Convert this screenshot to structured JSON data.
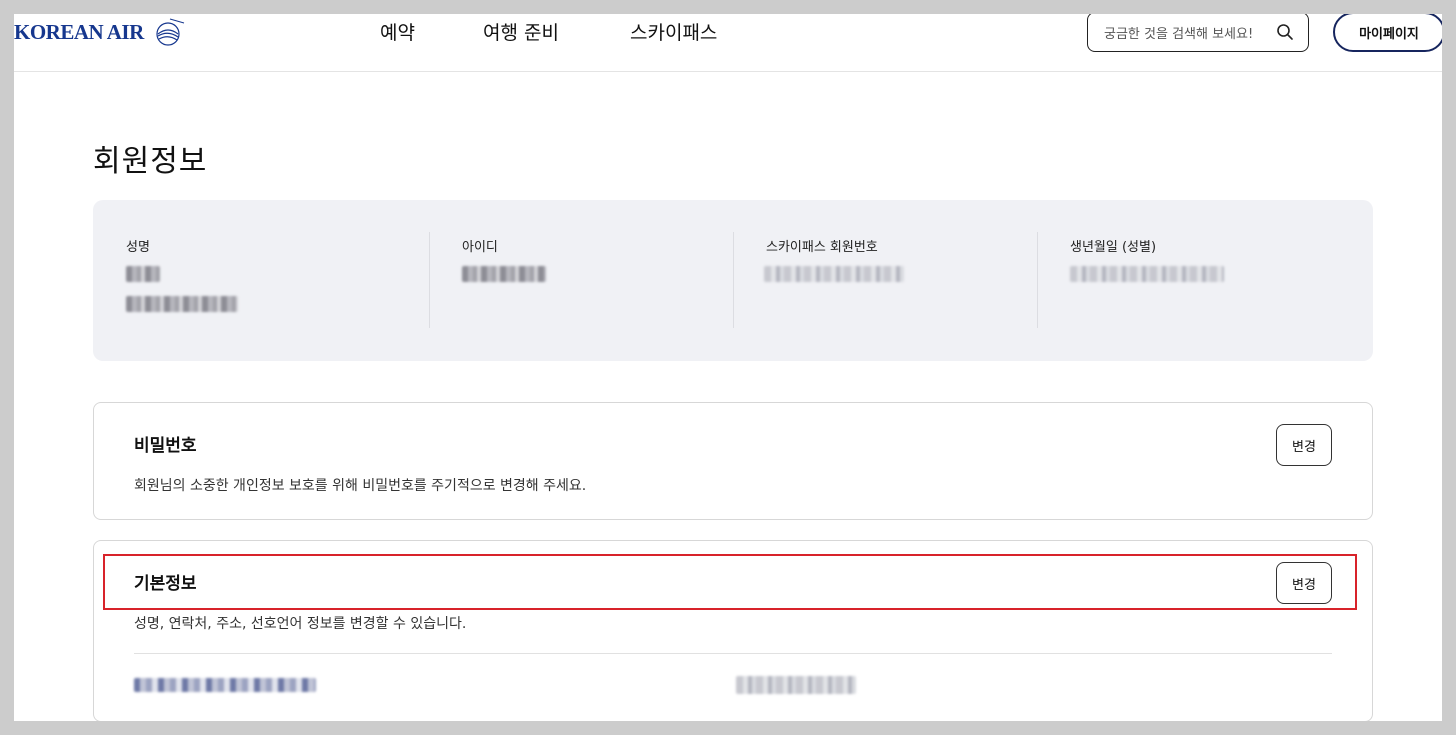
{
  "header": {
    "logo_text": "KOREAN AIR",
    "nav": [
      "예약",
      "여행 준비",
      "스카이패스"
    ],
    "search_placeholder": "궁금한 것을 검색해 보세요!",
    "mypage_label": "마이페이지"
  },
  "page_title": "회원정보",
  "summary": {
    "name_label": "성명",
    "id_label": "아이디",
    "skypass_label": "스카이패스 회원번호",
    "birth_label": "생년월일 (성별)"
  },
  "password_card": {
    "title": "비밀번호",
    "description": "회원님의 소중한 개인정보 보호를 위해 비밀번호를 주기적으로 변경해 주세요.",
    "button": "변경"
  },
  "basic_card": {
    "title": "기본정보",
    "description": "성명, 연락처, 주소, 선호언어 정보를 변경할 수 있습니다.",
    "button": "변경"
  },
  "colors": {
    "brand": "#16378e",
    "summary_bg": "#f0f1f5",
    "highlight": "#d8232a"
  }
}
